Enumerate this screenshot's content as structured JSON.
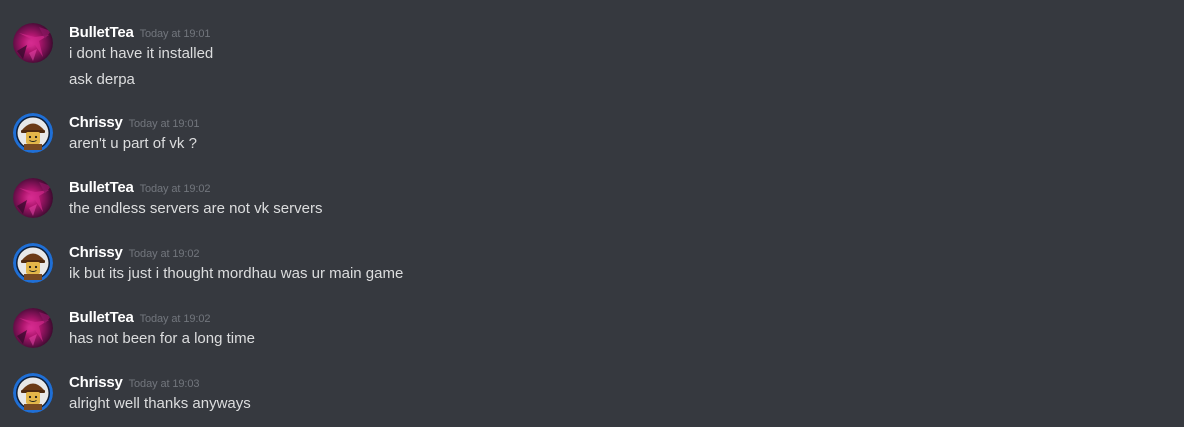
{
  "colors": {
    "background": "#36393f",
    "username": "#ffffff",
    "timestamp": "#72767d",
    "message_text": "#dcddde",
    "avatar_ring_blue": "#1f6fd6"
  },
  "messages": [
    {
      "author": "BulletTea",
      "avatar_icon": "purple-abstract-avatar-icon",
      "timestamp": "Today at 19:01",
      "lines": [
        "i dont have it installed",
        "ask derpa"
      ]
    },
    {
      "author": "Chrissy",
      "avatar_icon": "lego-minifigure-avatar-icon",
      "timestamp": "Today at 19:01",
      "lines": [
        "aren't u part of vk ?"
      ]
    },
    {
      "author": "BulletTea",
      "avatar_icon": "purple-abstract-avatar-icon",
      "timestamp": "Today at 19:02",
      "lines": [
        "the endless servers are not vk servers"
      ]
    },
    {
      "author": "Chrissy",
      "avatar_icon": "lego-minifigure-avatar-icon",
      "timestamp": "Today at 19:02",
      "lines": [
        "ik but its just i thought mordhau was ur main game"
      ]
    },
    {
      "author": "BulletTea",
      "avatar_icon": "purple-abstract-avatar-icon",
      "timestamp": "Today at 19:02",
      "lines": [
        "has not been for a long time"
      ]
    },
    {
      "author": "Chrissy",
      "avatar_icon": "lego-minifigure-avatar-icon",
      "timestamp": "Today at 19:03",
      "lines": [
        "alright well thanks anyways"
      ]
    }
  ]
}
